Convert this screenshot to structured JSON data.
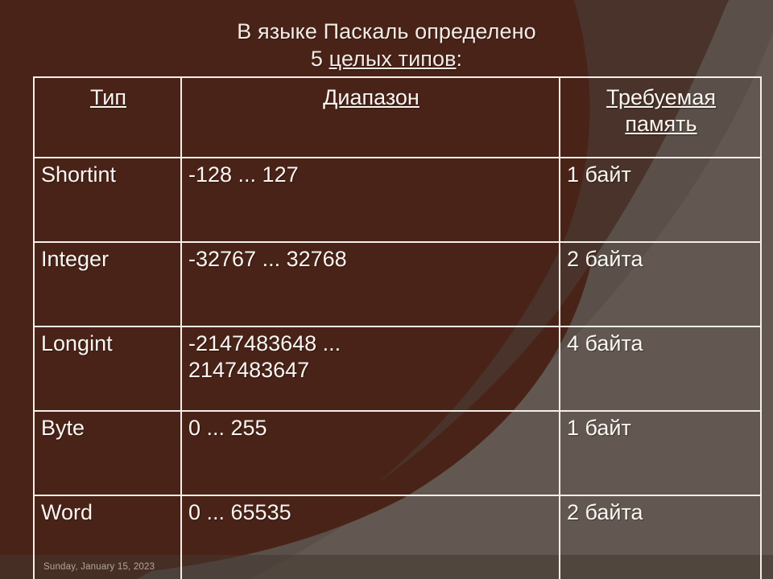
{
  "slide": {
    "title_line1": "В языке Паскаль определено",
    "title_line2_prefix": "5 ",
    "title_line2_underlined": "целых типов",
    "title_line2_suffix": ":",
    "footer_date": "Sunday, January 15, 2023"
  },
  "colors": {
    "background_maroon": "#4a2318",
    "background_brown": "#4a332a",
    "background_gray": "#5a4f49",
    "background_gray_light": "#6b6059",
    "border_white": "#f4efe9",
    "text_white": "#faf6f2",
    "footer_text": "#b5a49c"
  },
  "table": {
    "headers": [
      "Тип",
      "Диапазон",
      "Требуемая память"
    ],
    "header_memory_line1": "Требуемая",
    "header_memory_line2": "память",
    "rows": [
      {
        "type": "Shortint",
        "range": "-128 ... 127",
        "range_line1": "-128 ... 127",
        "range_line2": "",
        "memory": "1 байт"
      },
      {
        "type": "Integer",
        "range": "-32767 ... 32768",
        "range_line1": "-32767 ... 32768",
        "range_line2": "",
        "memory": "2 байта"
      },
      {
        "type": "Longint",
        "range": "-2147483648 ... 2147483647",
        "range_line1": "-2147483648 ...",
        "range_line2": "2147483647",
        "memory": "4 байта"
      },
      {
        "type": "Byte",
        "range": "0 ... 255",
        "range_line1": "0 ... 255",
        "range_line2": "",
        "memory": "1 байт"
      },
      {
        "type": "Word",
        "range": "0 ... 65535",
        "range_line1": "0 ... 65535",
        "range_line2": "",
        "memory": "2 байта"
      }
    ]
  }
}
